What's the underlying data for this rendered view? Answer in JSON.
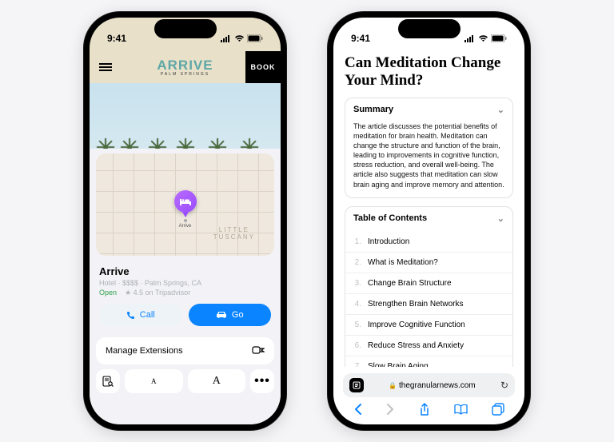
{
  "status": {
    "time": "9:41"
  },
  "left": {
    "brand_main": "ARRIVE",
    "brand_sub": "PALM SPRINGS",
    "book_label": "BOOK",
    "map": {
      "neighborhood": "LITTLE\nTUSCANY",
      "pin_label": "Arrive"
    },
    "place": {
      "name": "Arrive",
      "meta": "Hotel · $$$$ · Palm Springs, CA",
      "open": "Open",
      "rating": "★ 4.5 on Tripadvisor"
    },
    "call_label": "Call",
    "go_label": "Go",
    "manage_label": "Manage Extensions"
  },
  "right": {
    "title": "Can Meditation Change Your Mind?",
    "summary_head": "Summary",
    "summary_body": "The article discusses the potential benefits of meditation for brain health. Meditation can change the structure and function of the brain, leading to improvements in cognitive function, stress reduction, and overall well-being. The article also suggests that meditation can slow brain aging and improve memory and attention.",
    "toc_head": "Table of Contents",
    "toc": [
      "Introduction",
      "What is Meditation?",
      "Change Brain Structure",
      "Strengthen Brain Networks",
      "Improve Cognitive Function",
      "Reduce Stress and Anxiety",
      "Slow Brain Aging"
    ],
    "url_host": "thegranularnews.com"
  }
}
